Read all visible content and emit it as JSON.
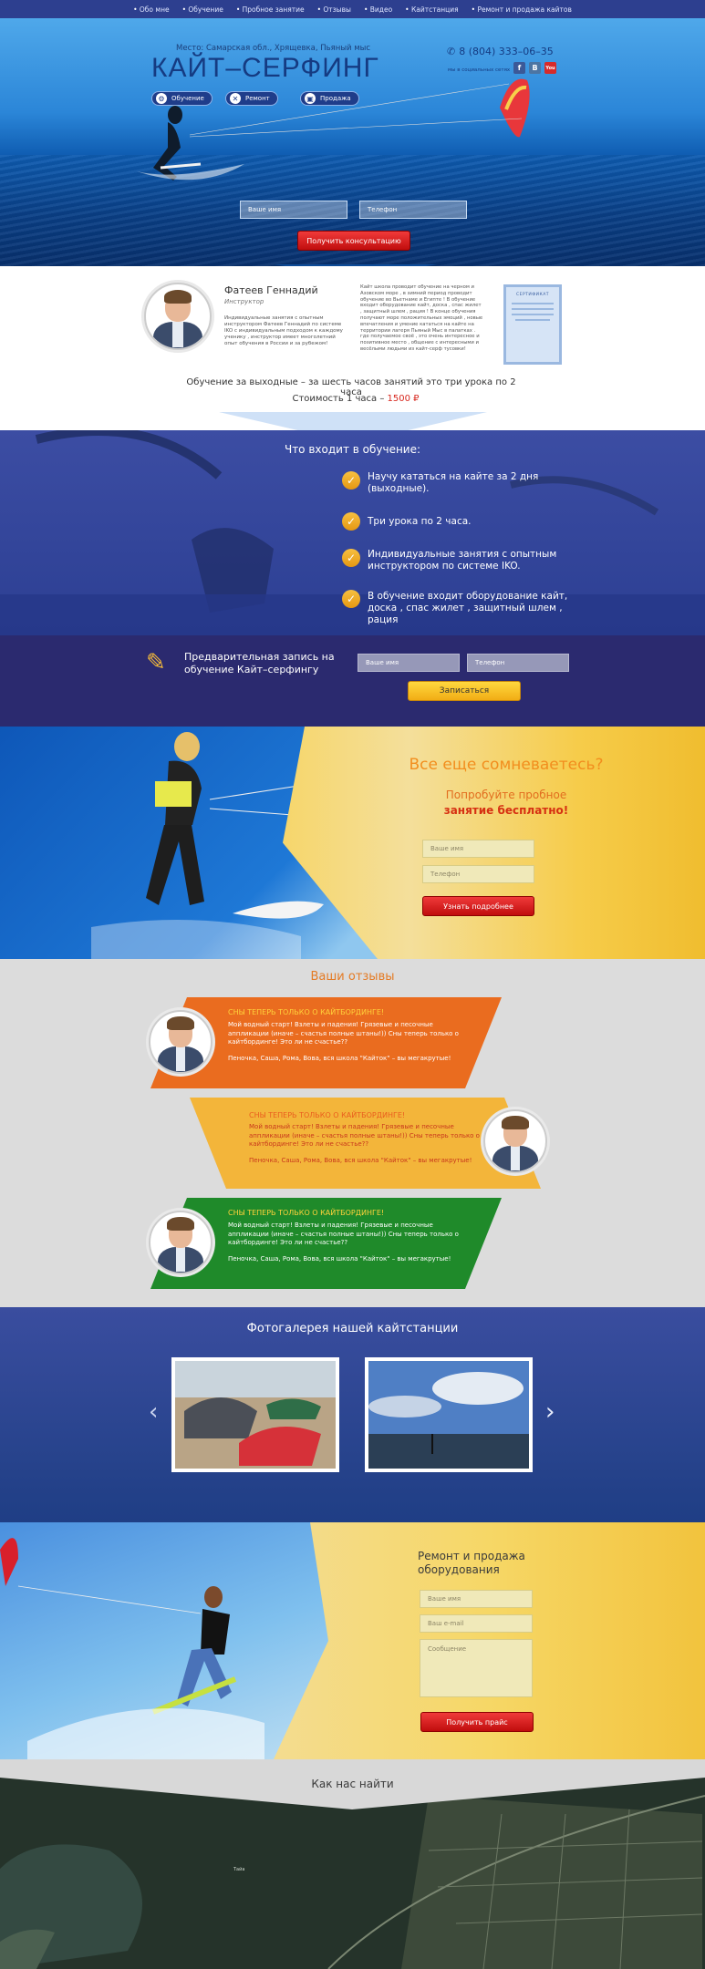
{
  "nav": [
    "Обо мне",
    "Обучение",
    "Пробное занятие",
    "Отзывы",
    "Видео",
    "Кайтстанция",
    "Ремонт и продажа кайтов"
  ],
  "hero": {
    "place": "Место: Самарская обл., Хрящевка, Пьяный мыс",
    "title": "КАЙТ–СЕРФИНГ",
    "pills": [
      "Обучение",
      "Ремонт",
      "Продажа"
    ],
    "phone": "8 (804) 333–06–35",
    "social_label": "мы в социальных сетях",
    "social": [
      "f",
      "B",
      "You"
    ],
    "name_placeholder": "Ваше имя",
    "phone_placeholder": "Телефон",
    "cta": "Получить консультацию"
  },
  "instructor": {
    "name": "Фатеев Геннадий",
    "role": "Инструктор",
    "about": "Индивидуальные занятия с опытным инструктором Фатеев Геннадий по системе IKO с индивидуальным подходом к каждому ученику , инструктор имеет многолетний опыт обучения в России и за рубежом!",
    "school_text": "Кайт школа проводит обучение на черном и Азовском море , в зимний период проводит обучение во Вьетнаме и Египте ! В обучение входит оборудование кайт, доска , спас жилет , защитный шлем , рация ! В конце обучения получают море положительных эмоций , новые впечатления и умение кататься на кайте на территории лагеря Пьяный Мыс в палатках . где получаемое своё , это очень интересное и позитивное место , общение с интересными и весёлыми людьми из кайт-серф тусовки!",
    "cert_label": "СЕРТИФИКАТ",
    "schedule": "Обучение за выходные  – за шесть часов занятий это три урока по 2 часа",
    "price_label": "Стоимость 1 часа –",
    "price": "1500 ₽"
  },
  "included": {
    "title": "Что входит в обучение:",
    "items": [
      "Научу кататься на кайте за 2 дня (выходные).",
      "Три урока по 2 часа.",
      "Индивидуальные занятия с опытным инструктором по системе IKO.",
      "В обучение входит оборудование кайт, доска , спас жилет , защитный шлем , рация"
    ]
  },
  "signup": {
    "title": "Предварительная запись на обучение Кайт–серфингу",
    "name_placeholder": "Ваше имя",
    "phone_placeholder": "Телефон",
    "button": "Записаться"
  },
  "doubt": {
    "title": "Все еще сомневаетесь?",
    "subtitle": "Попробуйте пробное",
    "subtitle_bold": "занятие бесплатно!",
    "name_placeholder": "Ваше имя",
    "phone_placeholder": "Телефон",
    "button": "Узнать подробнее"
  },
  "reviews": {
    "title": "Ваши отзывы",
    "items": [
      {
        "heading": "СНЫ ТЕПЕРЬ ТОЛЬКО О КАЙТБОРДИНГЕ!",
        "text": "Мой водный старт! Взлеты и падения! Грязевые и песочные аппликации (иначе – счастья полные штаны!)) Сны теперь только о кайтбординге! Это ли не счастье??",
        "author": "Пеночка, Саша, Рома, Вова, вся школа \"Кайток\" – вы мегакрутые!",
        "color": "#ea6c1f"
      },
      {
        "heading": "СНЫ ТЕПЕРЬ ТОЛЬКО О КАЙТБОРДИНГЕ!",
        "text": "Мой водный старт! Взлеты и падения! Грязевые и песочные аппликации (иначе – счастья полные штаны!)) Сны теперь только о кайтбординге! Это ли не счастье??",
        "author": "Пеночка, Саша, Рома, Вова, вся школа \"Кайток\" – вы мегакрутые!",
        "color": "#f3b53a"
      },
      {
        "heading": "СНЫ ТЕПЕРЬ ТОЛЬКО О КАЙТБОРДИНГЕ!",
        "text": "Мой водный старт! Взлеты и падения! Грязевые и песочные аппликации (иначе – счастья полные штаны!)) Сны теперь только о кайтбординге! Это ли не счастье??",
        "author": "Пеночка, Саша, Рома, Вова, вся школа \"Кайток\" – вы мегакрутые!",
        "color": "#1f8a2a"
      }
    ]
  },
  "gallery": {
    "title": "Фотогалерея нашей кайтстанции"
  },
  "shop": {
    "title": "Ремонт и продажа оборудования",
    "name_placeholder": "Ваше имя",
    "email_placeholder": "Ваш e-mail",
    "message_placeholder": "Сообщение",
    "button": "Получить прайс"
  },
  "map": {
    "title": "Как нас найти",
    "label": "Тайа"
  }
}
